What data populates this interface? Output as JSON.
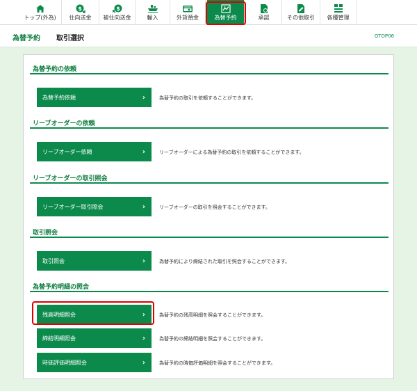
{
  "nav": {
    "items": [
      {
        "label": "トップ(外為)",
        "icon": "home-icon"
      },
      {
        "label": "仕向送金",
        "icon": "outward-remittance-icon"
      },
      {
        "label": "被仕向送金",
        "icon": "inward-remittance-icon"
      },
      {
        "label": "輸入",
        "icon": "import-ship-icon"
      },
      {
        "label": "外貨預金",
        "icon": "foreign-deposit-icon"
      },
      {
        "label": "為替予約",
        "icon": "fx-contract-icon"
      },
      {
        "label": "承認",
        "icon": "approval-icon"
      },
      {
        "label": "その他取引",
        "icon": "other-transactions-icon"
      },
      {
        "label": "各種管理",
        "icon": "management-icon"
      }
    ],
    "active_index": 5
  },
  "header": {
    "category": "為替予約",
    "page_title": "取引選択",
    "screen_code": "GTOP06"
  },
  "sections": [
    {
      "title": "為替予約の依頼",
      "buttons": [
        {
          "label": "為替予約依頼",
          "description": "為替予約の取引を依頼することができます。"
        }
      ]
    },
    {
      "title": "リーブオーダーの依頼",
      "buttons": [
        {
          "label": "リーブオーダー依頼",
          "description": "リーブオーダーによる為替予約の取引を依頼することができます。"
        }
      ]
    },
    {
      "title": "リーブオーダーの取引照会",
      "buttons": [
        {
          "label": "リーブオーダー取引照会",
          "description": "リーブオーダーの取引を照会することができます。"
        }
      ]
    },
    {
      "title": "取引照会",
      "buttons": [
        {
          "label": "取引照会",
          "description": "為替予約により締結された取引を照会することができます。"
        }
      ]
    },
    {
      "title": "為替予約明細の照会",
      "buttons": [
        {
          "label": "残高明細照会",
          "description": "為替予約の残高明細を照会することができます。"
        },
        {
          "label": "締結明細照会",
          "description": "為替予約の締結明細を照会することができます。"
        },
        {
          "label": "時価評価明細照会",
          "description": "為替予約の時価評価明細を照会することができます。"
        }
      ]
    }
  ],
  "colors": {
    "brand_green": "#0c8a4c",
    "highlight_red": "#e00000",
    "background_green": "#e6f4e6"
  }
}
